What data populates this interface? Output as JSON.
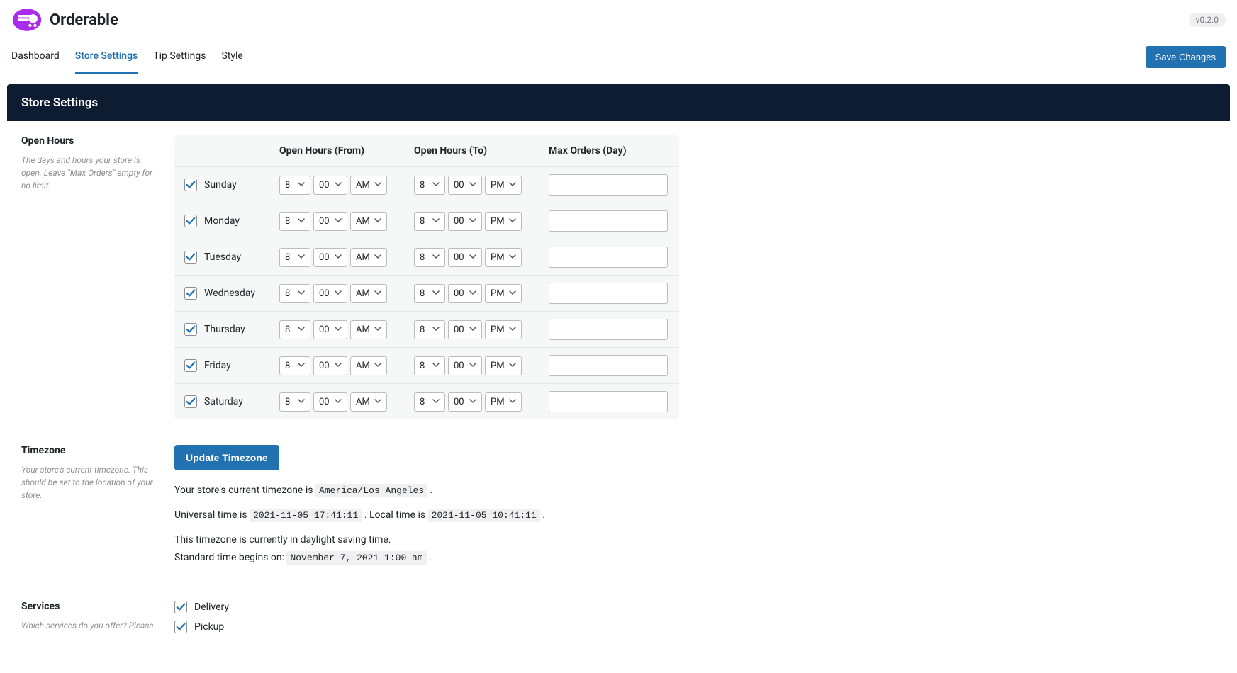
{
  "brand": {
    "name": "Orderable"
  },
  "version": "v0.2.0",
  "tabs": [
    {
      "label": "Dashboard",
      "active": false
    },
    {
      "label": "Store Settings",
      "active": true
    },
    {
      "label": "Tip Settings",
      "active": false
    },
    {
      "label": "Style",
      "active": false
    }
  ],
  "save_button": "Save Changes",
  "page_title": "Store Settings",
  "open_hours": {
    "label": "Open Hours",
    "desc": "The days and hours your store is open. Leave \"Max Orders\" empty for no limit.",
    "columns": {
      "from": "Open Hours (From)",
      "to": "Open Hours (To)",
      "max": "Max Orders (Day)"
    },
    "rows": [
      {
        "day": "Sunday",
        "enabled": true,
        "from_h": "8",
        "from_m": "00",
        "from_ap": "AM",
        "to_h": "8",
        "to_m": "00",
        "to_ap": "PM",
        "max": ""
      },
      {
        "day": "Monday",
        "enabled": true,
        "from_h": "8",
        "from_m": "00",
        "from_ap": "AM",
        "to_h": "8",
        "to_m": "00",
        "to_ap": "PM",
        "max": ""
      },
      {
        "day": "Tuesday",
        "enabled": true,
        "from_h": "8",
        "from_m": "00",
        "from_ap": "AM",
        "to_h": "8",
        "to_m": "00",
        "to_ap": "PM",
        "max": ""
      },
      {
        "day": "Wednesday",
        "enabled": true,
        "from_h": "8",
        "from_m": "00",
        "from_ap": "AM",
        "to_h": "8",
        "to_m": "00",
        "to_ap": "PM",
        "max": ""
      },
      {
        "day": "Thursday",
        "enabled": true,
        "from_h": "8",
        "from_m": "00",
        "from_ap": "AM",
        "to_h": "8",
        "to_m": "00",
        "to_ap": "PM",
        "max": ""
      },
      {
        "day": "Friday",
        "enabled": true,
        "from_h": "8",
        "from_m": "00",
        "from_ap": "AM",
        "to_h": "8",
        "to_m": "00",
        "to_ap": "PM",
        "max": ""
      },
      {
        "day": "Saturday",
        "enabled": true,
        "from_h": "8",
        "from_m": "00",
        "from_ap": "AM",
        "to_h": "8",
        "to_m": "00",
        "to_ap": "PM",
        "max": ""
      }
    ]
  },
  "timezone": {
    "label": "Timezone",
    "desc": "Your store's current timezone. This should be set to the location of your store.",
    "button": "Update Timezone",
    "line1_pre": "Your store's current timezone is ",
    "tz_value": "America/Los_Angeles",
    "line1_post": " .",
    "line2_pre": "Universal time is ",
    "utc": "2021-11-05 17:41:11",
    "line2_mid": " . Local time is ",
    "local": "2021-11-05 10:41:11",
    "line2_post": " .",
    "line3": "This timezone is currently in daylight saving time.",
    "line4_pre": "Standard time begins on: ",
    "std": "November 7, 2021 1:00 am",
    "line4_post": " ."
  },
  "services": {
    "label": "Services",
    "desc": "Which services do you offer? Please",
    "items": [
      {
        "label": "Delivery",
        "checked": true
      },
      {
        "label": "Pickup",
        "checked": true
      }
    ]
  }
}
